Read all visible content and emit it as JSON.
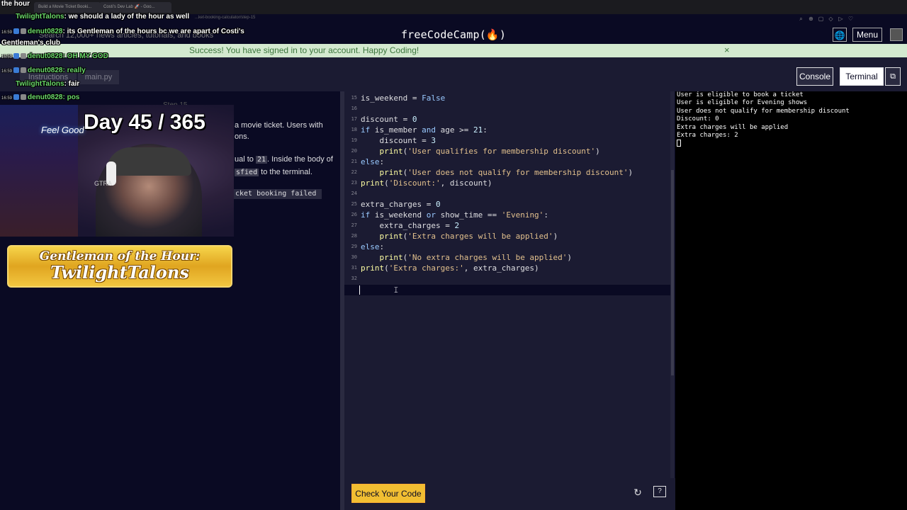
{
  "browser": {
    "tabs": [
      "Build a Movie Ticket Booki...",
      "Costi's Dev Lab 🚀 - Goo..."
    ],
    "url_fragment": "...ket-booking-calculator/step-15"
  },
  "nav": {
    "logo": "freeCodeCamp(🔥)",
    "globe_icon": "globe-icon",
    "menu_label": "Menu"
  },
  "banner": {
    "message": "Success! You have signed in to your account. Happy Coding!",
    "close": "×"
  },
  "toolbar": {
    "search_placeholder": "Search 12,000+ news articles, tutorials, and books",
    "tab_instructions": "Instructions",
    "tab_main": "main.py",
    "console_label": "Console",
    "terminal_label": "Terminal",
    "split_icon": "⧉"
  },
  "instructions": {
    "step_title": "Step 15",
    "line1": "a movie ticket. Users with",
    "line2": "ons.",
    "line3_a": "ual to ",
    "line3_code": "21",
    "line3_b": ". Inside the body of",
    "line4_code": "sfied",
    "line4_b": " to the terminal.",
    "expected": "cket booking failed"
  },
  "stream": {
    "day_counter": "Day 45 / 365",
    "neon_sign": "Feel Good",
    "mic_brand": "GTRA",
    "gentleman_title": "Gentleman of the Hour:",
    "gentleman_name": "TwilightTalons",
    "header_hour": "the hour"
  },
  "chat": [
    {
      "time": "",
      "user": "TwilightTalons",
      "msg": ": we should a lady of the hour as well",
      "color": "white"
    },
    {
      "time": "16:59",
      "user": "denut0828",
      "msg": ": its Gentleman of the hours bc we are apart of Costi's",
      "color": "white"
    },
    {
      "time": "",
      "user": "",
      "msg": "Gentleman's club",
      "color": "white"
    },
    {
      "time": "16:59",
      "user": "denut0828",
      "msg": ": OH MY GOD",
      "color": "green"
    },
    {
      "time": "16:59",
      "user": "denut0828",
      "msg": ": really",
      "color": "green"
    },
    {
      "time": "",
      "user": "TwilightTalons",
      "msg": ": fair",
      "color": "white"
    },
    {
      "time": "16:59",
      "user": "denut0828",
      "msg": ": pos",
      "color": "green"
    }
  ],
  "editor": {
    "lines": [
      {
        "n": "15",
        "html": "is_weekend = <span class=\"kw\">False</span>"
      },
      {
        "n": "16",
        "html": ""
      },
      {
        "n": "17",
        "html": "discount = <span class=\"num\">0</span>"
      },
      {
        "n": "18",
        "html": "<span class=\"kw\">if</span> is_member <span class=\"kw\">and</span> age >= <span class=\"num\">21</span>:"
      },
      {
        "n": "19",
        "html": "    discount = <span class=\"num\">3</span>"
      },
      {
        "n": "20",
        "html": "    <span class=\"fn\">print</span>(<span class=\"str\">'User qualifies for membership discount'</span>)"
      },
      {
        "n": "21",
        "html": "<span class=\"kw\">else</span>:"
      },
      {
        "n": "22",
        "html": "    <span class=\"fn\">print</span>(<span class=\"str\">'User does not qualify for membership discount'</span>)"
      },
      {
        "n": "23",
        "html": "<span class=\"fn\">print</span>(<span class=\"str\">'Discount:'</span>, discount)"
      },
      {
        "n": "24",
        "html": ""
      },
      {
        "n": "25",
        "html": "extra_charges = <span class=\"num\">0</span>"
      },
      {
        "n": "26",
        "html": "<span class=\"kw\">if</span> is_weekend <span class=\"kw\">or</span> show_time == <span class=\"str\">'Evening'</span>:"
      },
      {
        "n": "27",
        "html": "    extra_charges = <span class=\"num\">2</span>"
      },
      {
        "n": "28",
        "html": "    <span class=\"fn\">print</span>(<span class=\"str\">'Extra charges will be applied'</span>)"
      },
      {
        "n": "29",
        "html": "<span class=\"kw\">else</span>:"
      },
      {
        "n": "30",
        "html": "    <span class=\"fn\">print</span>(<span class=\"str\">'No extra charges will be applied'</span>)"
      },
      {
        "n": "31",
        "html": "<span class=\"fn\">print</span>(<span class=\"str\">'Extra charges:'</span>, extra_charges)"
      },
      {
        "n": "32",
        "html": ""
      },
      {
        "n": "33",
        "html": ""
      }
    ]
  },
  "terminal": {
    "lines": [
      "User is eligible to book a ticket",
      "User is eligible for Evening shows",
      "User does not qualify for membership discount",
      "Discount: 0",
      "Extra charges will be applied",
      "Extra charges: 2"
    ]
  },
  "bottom": {
    "check_label": "Check Your Code",
    "reset_icon": "↻",
    "help_icon": "?"
  }
}
